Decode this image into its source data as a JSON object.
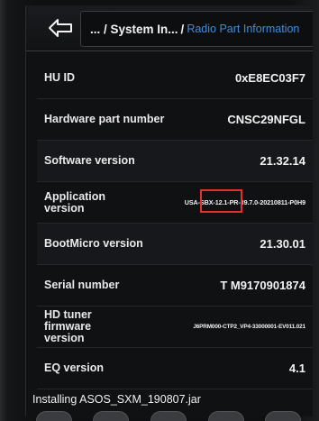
{
  "header": {
    "path_main": "... / System In...",
    "path_sep": "/",
    "path_current": "Radio Part Information"
  },
  "rows": [
    {
      "label": "HU ID",
      "value": "0xE8EC03F7"
    },
    {
      "label": "Hardware part number",
      "value": "CNSC29NFGL"
    },
    {
      "label": "Software version",
      "value": "21.32.14"
    },
    {
      "label": "Application version",
      "value": "USA-SBX-12.1-PR-39.7.0-20210811-P0H9",
      "highlighted_segment": "PR-39.7.0"
    },
    {
      "label": "BootMicro version",
      "value": "21.30.01"
    },
    {
      "label": "Serial number",
      "value": "T M9170901874"
    },
    {
      "label": "HD tuner firmware version",
      "value": "J6PRM000-CTP2_VP4-33000001-EV011.021"
    },
    {
      "label": "EQ version",
      "value": "4.1"
    }
  ],
  "status": {
    "text": "Installing ASOS_SXM_190807.jar"
  },
  "colors": {
    "accent": "#3d8ddf",
    "highlight": "#e33030",
    "background": "#101113"
  }
}
